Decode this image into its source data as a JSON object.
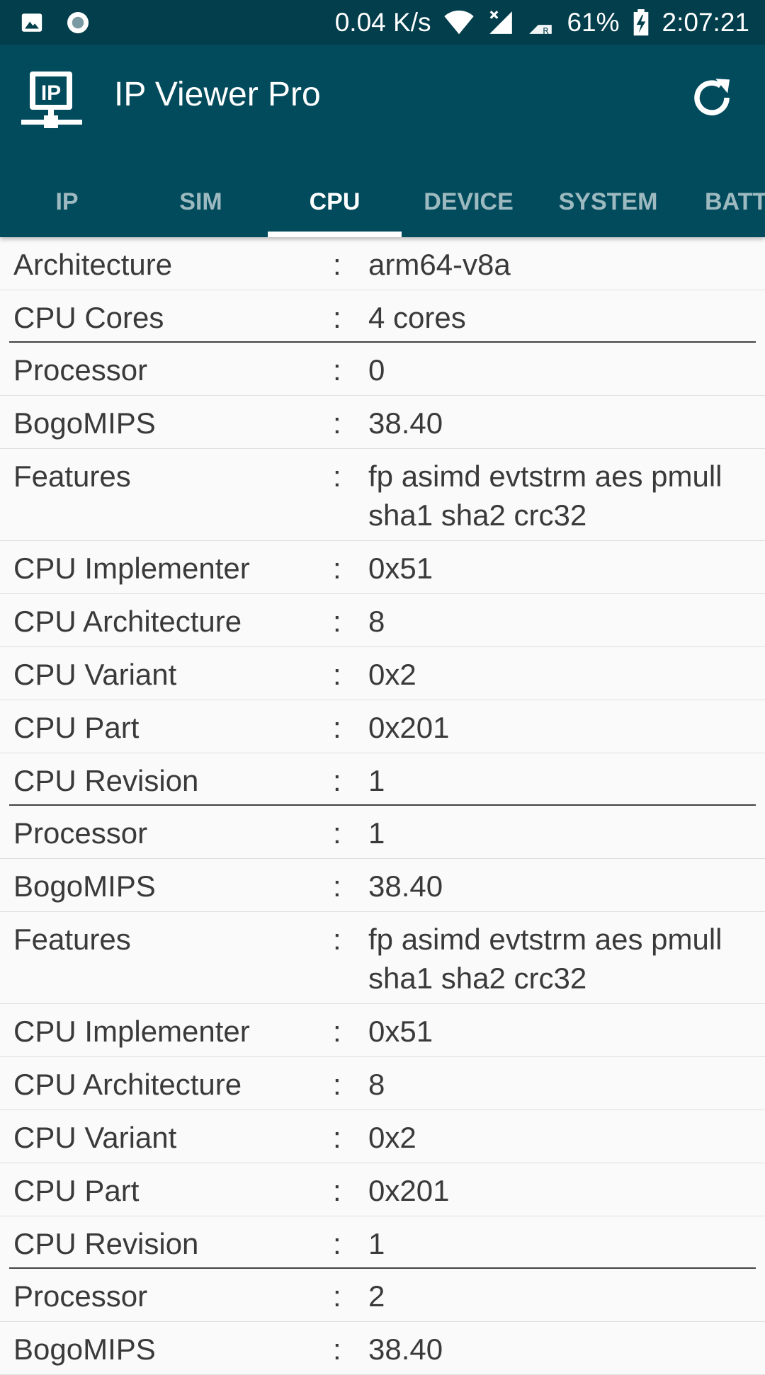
{
  "status_bar": {
    "net_speed": "0.04 K/s",
    "battery": "61%",
    "time": "2:07:21",
    "icons": [
      "image-icon",
      "record-icon",
      "wifi-icon",
      "no-signal-icon",
      "roaming-signal-icon",
      "battery-charging-icon"
    ]
  },
  "app_bar": {
    "logo_text": "IP",
    "title": "IP Viewer Pro",
    "refresh_icon": "refresh-icon",
    "background": "#024b5c"
  },
  "tabs": [
    {
      "label": "IP"
    },
    {
      "label": "SIM"
    },
    {
      "label": "CPU",
      "active": true
    },
    {
      "label": "DEVICE"
    },
    {
      "label": "SYSTEM"
    },
    {
      "label": "BATT"
    }
  ],
  "rows": [
    {
      "key": "Architecture",
      "sep": ":",
      "value": "arm64-v8a"
    },
    {
      "key": "CPU Cores",
      "sep": ":",
      "value": "4 cores",
      "divider": true
    },
    {
      "key": "Processor",
      "sep": ":",
      "value": "0"
    },
    {
      "key": "BogoMIPS",
      "sep": ":",
      "value": "38.40"
    },
    {
      "key": "Features",
      "sep": ":",
      "value": "fp asimd evtstrm aes pmull sha1 sha2 crc32"
    },
    {
      "key": "CPU Implementer",
      "sep": ":",
      "value": "0x51"
    },
    {
      "key": "CPU Architecture",
      "sep": ":",
      "value": "8"
    },
    {
      "key": "CPU Variant",
      "sep": ":",
      "value": "0x2"
    },
    {
      "key": "CPU Part",
      "sep": ":",
      "value": "0x201"
    },
    {
      "key": "CPU Revision",
      "sep": ":",
      "value": "1",
      "divider": true
    },
    {
      "key": "Processor",
      "sep": ":",
      "value": "1"
    },
    {
      "key": "BogoMIPS",
      "sep": ":",
      "value": "38.40"
    },
    {
      "key": "Features",
      "sep": ":",
      "value": "fp asimd evtstrm aes pmull sha1 sha2 crc32"
    },
    {
      "key": "CPU Implementer",
      "sep": ":",
      "value": "0x51"
    },
    {
      "key": "CPU Architecture",
      "sep": ":",
      "value": "8"
    },
    {
      "key": "CPU Variant",
      "sep": ":",
      "value": "0x2"
    },
    {
      "key": "CPU Part",
      "sep": ":",
      "value": "0x201"
    },
    {
      "key": "CPU Revision",
      "sep": ":",
      "value": "1",
      "divider": true
    },
    {
      "key": "Processor",
      "sep": ":",
      "value": "2"
    },
    {
      "key": "BogoMIPS",
      "sep": ":",
      "value": "38.40"
    }
  ]
}
